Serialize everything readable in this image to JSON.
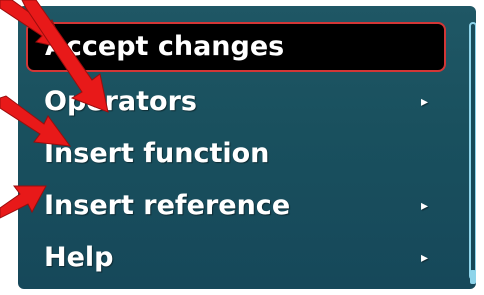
{
  "menu": {
    "items": [
      {
        "label": "Accept changes",
        "selected": true,
        "has_submenu": false
      },
      {
        "label": "Operators",
        "selected": false,
        "has_submenu": true
      },
      {
        "label": "Insert function",
        "selected": false,
        "has_submenu": false
      },
      {
        "label": "Insert reference",
        "selected": false,
        "has_submenu": true
      },
      {
        "label": "Help",
        "selected": false,
        "has_submenu": true
      }
    ],
    "submenu_glyph": "▸"
  },
  "colors": {
    "panel_background": "#1b5261",
    "selected_background": "#000000",
    "selected_border": "#d23636",
    "scrollbar": "#8ed4ea",
    "annotation_arrow": "#e81919"
  },
  "annotations": {
    "arrow_count": 4,
    "icon": "red-arrow-icon"
  }
}
